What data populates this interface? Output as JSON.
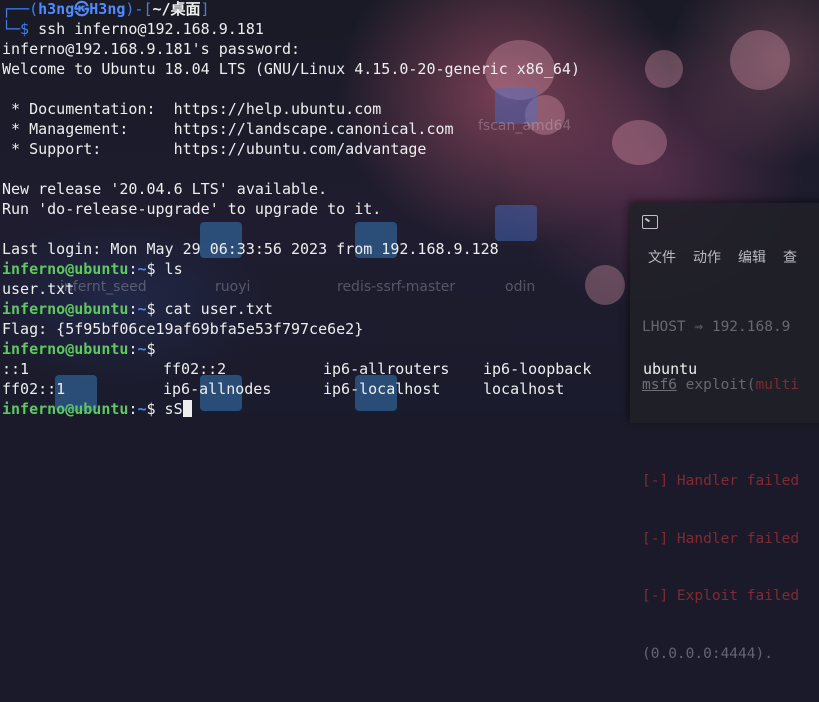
{
  "desktop": {
    "icons": [
      {
        "label": "fscan_amd64"
      },
      {
        "label": "ruoyi"
      },
      {
        "label": "redis-ssrf-master"
      },
      {
        "label": "odin"
      },
      {
        "label": "infernt_seed"
      }
    ]
  },
  "right_window": {
    "menu": [
      "文件",
      "动作",
      "编辑",
      "查"
    ],
    "lines": [
      {
        "text": "LHOST ⇒ 192.168.9"
      },
      {
        "prefix": "msf6",
        "rest": " exploit(",
        "tail": "multi"
      },
      {
        "text": ""
      },
      {
        "text": "[-] Handler failed"
      },
      {
        "text": "[-] Handler failed"
      },
      {
        "text": "[-] Exploit failed"
      },
      {
        "text": "(0.0.0.0:4444)."
      }
    ]
  },
  "prompt": {
    "user": "h3ng",
    "symbol": "㉿",
    "host": "H3ng",
    "path": "~/桌面",
    "ssh_command": "ssh inferno@192.168.9.181"
  },
  "session": {
    "password_prompt": "inferno@192.168.9.181's password:",
    "welcome": "Welcome to Ubuntu 18.04 LTS (GNU/Linux 4.15.0-20-generic x86_64)",
    "doc": " * Documentation:  https://help.ubuntu.com",
    "mgmt": " * Management:     https://landscape.canonical.com",
    "support": " * Support:        https://ubuntu.com/advantage",
    "release": "New release '20.04.6 LTS' available.",
    "upgrade": "Run 'do-release-upgrade' to upgrade to it.",
    "last_login": "Last login: Mon May 29 06:33:56 2023 from 192.168.9.128"
  },
  "remote_prompt": {
    "user_host": "inferno@ubuntu",
    "sep": ":",
    "path": "~",
    "dollar": "$"
  },
  "commands": {
    "ls": " ls",
    "ls_output": "user.txt",
    "cat": " cat user.txt",
    "flag": "Flag: {5f95bf06ce19af69bfa5e53f797ce6e2}",
    "current": " sS"
  },
  "completions": {
    "row1": [
      "::1",
      "ff02::2",
      "ip6-allrouters",
      "ip6-loopback",
      "ubuntu"
    ],
    "row2": [
      "ff02::1",
      "ip6-allnodes",
      "ip6-localhost",
      "localhost"
    ]
  }
}
